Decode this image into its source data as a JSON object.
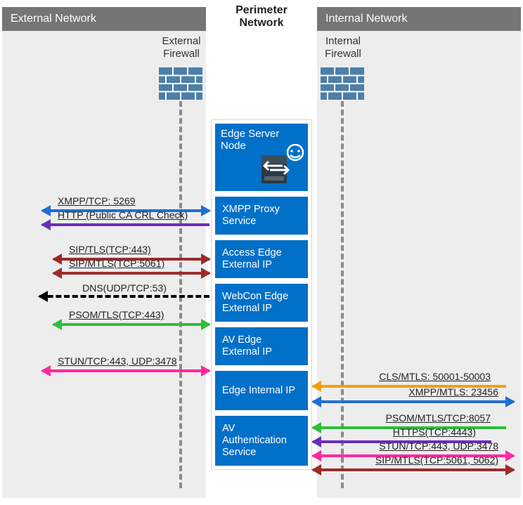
{
  "headers": {
    "external": "External Network",
    "perimeter_l1": "Perimeter",
    "perimeter_l2": "Network",
    "internal": "Internal Network"
  },
  "firewalls": {
    "external_l1": "External",
    "external_l2": "Firewall",
    "internal_l1": "Internal",
    "internal_l2": "Firewall"
  },
  "edge": {
    "title_l1": "Edge Server",
    "title_l2": "Node",
    "boxes": {
      "xmpp": "XMPP Proxy Service",
      "access": "Access Edge External IP",
      "webcon": "WebCon Edge External IP",
      "av": "AV Edge External IP",
      "internal": "Edge Internal IP",
      "avauth": "AV Authentication Service"
    }
  },
  "arrows_left": {
    "xmpp": "XMPP/TCP: 5269",
    "http": "HTTP (Public CA CRL Check)",
    "sip_tls": "SIP/TLS(TCP:443)",
    "sip_mtls": "SIP/MTLS(TCP:5061)",
    "dns": "DNS(UDP/TCP:53)",
    "psom": "PSOM/TLS(TCP:443)",
    "stun": "STUN/TCP:443, UDP:3478"
  },
  "arrows_right": {
    "cls": "CLS/MTLS: 50001-50003",
    "xmpp": "XMPP/MTLS: 23456",
    "psom": "PSOM/MTLS/TCP:8057",
    "https": "HTTPS(TCP:4443)",
    "stun": "STUN/TCP:443, UDP:3478",
    "sip": "SIP/MTLS(TCP:5061, 5062)"
  }
}
